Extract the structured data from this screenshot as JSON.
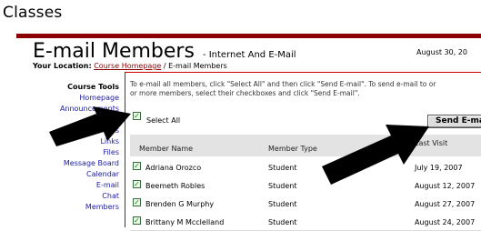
{
  "app": {
    "section_title": "Classes"
  },
  "page": {
    "title": "E-mail Members",
    "subtitle": "- Internet And E-Mail",
    "date": "August 30, 20",
    "location_label": "Your Location:",
    "location_link": "Course Homepage",
    "location_current": "/ E-mail Members"
  },
  "sidebar": {
    "heading": "Course Tools",
    "items": [
      "Homepage",
      "Announcements",
      "",
      "tos",
      "Links",
      "Files",
      "Message Board",
      "Calendar",
      "E-mail",
      "Chat",
      "Members"
    ]
  },
  "instructions": {
    "line1": "To e-mail all members, click \"Select All\" and then click \"Send E-mail\". To send e-mail to or",
    "line2": "or more members, select their checkboxes and click \"Send E-mail\"."
  },
  "select_all": {
    "label": "Select All",
    "checked": true
  },
  "send_button": {
    "label": "Send E-ma"
  },
  "table": {
    "headers": {
      "name": "Member Name",
      "type": "Member Type",
      "last_visit": "Last Visit"
    },
    "rows": [
      {
        "name": "Adriana Orozco",
        "type": "Student",
        "last_visit": "July 19, 2007",
        "checked": true
      },
      {
        "name": "Beemeth Robles",
        "type": "Student",
        "last_visit": "August 12, 2007",
        "checked": true
      },
      {
        "name": "Brenden G Murphy",
        "type": "Student",
        "last_visit": "August 27, 2007",
        "checked": true
      },
      {
        "name": "Brittany M Mcclelland",
        "type": "Student",
        "last_visit": "August 24, 2007",
        "checked": true
      }
    ]
  },
  "colors": {
    "accent": "#8b0000",
    "link": "#1a1aa6",
    "border": "#cc0000"
  }
}
